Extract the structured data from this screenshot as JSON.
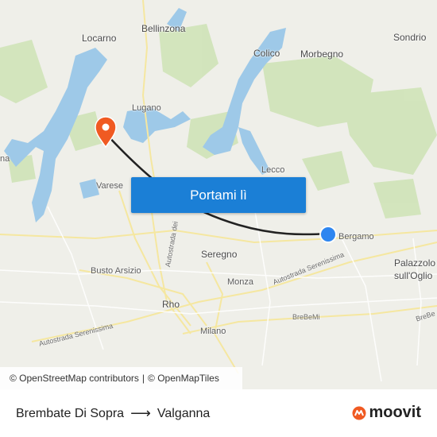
{
  "map": {
    "places": [
      {
        "id": "locarno",
        "label": "Locarno"
      },
      {
        "id": "bellinzona",
        "label": "Bellinzona"
      },
      {
        "id": "colico",
        "label": "Colico"
      },
      {
        "id": "morbegno",
        "label": "Morbegno"
      },
      {
        "id": "sondrio",
        "label": "Sondrio"
      },
      {
        "id": "lugano",
        "label": "Lugano"
      },
      {
        "id": "varese",
        "label": "Varese"
      },
      {
        "id": "lecco",
        "label": "Lecco"
      },
      {
        "id": "bergamo",
        "label": "Bergamo"
      },
      {
        "id": "palazzolo",
        "label": "Palazzolo"
      },
      {
        "id": "sulloglio",
        "label": "sull'Oglio"
      },
      {
        "id": "seregno",
        "label": "Seregno"
      },
      {
        "id": "monza",
        "label": "Monza"
      },
      {
        "id": "busto",
        "label": "Busto Arsizio"
      },
      {
        "id": "rho",
        "label": "Rho"
      },
      {
        "id": "milano",
        "label": "Milano"
      },
      {
        "id": "na",
        "label": "na"
      }
    ],
    "roads": {
      "serenissima_east": "Autostrada Serenissima",
      "serenissima_west": "Autostrada Serenissima",
      "brebemi": "BreBeMi",
      "brebe_short": "BreBe",
      "autostrada_dei": "Autostrada dei"
    },
    "cta_label": "Portami lì",
    "attribution": {
      "osm": "© OpenStreetMap contributors",
      "sep": "|",
      "omt": "© OpenMapTiles"
    },
    "colors": {
      "route": "#222222",
      "destination_pin": "#f05a22",
      "origin_dot": "#2e86f0",
      "water": "#9ec9e8",
      "cta": "#1b7fd6"
    }
  },
  "footer": {
    "origin": "Brembate Di Sopra",
    "arrow": "⟶",
    "destination": "Valganna",
    "brand": "moovit"
  }
}
